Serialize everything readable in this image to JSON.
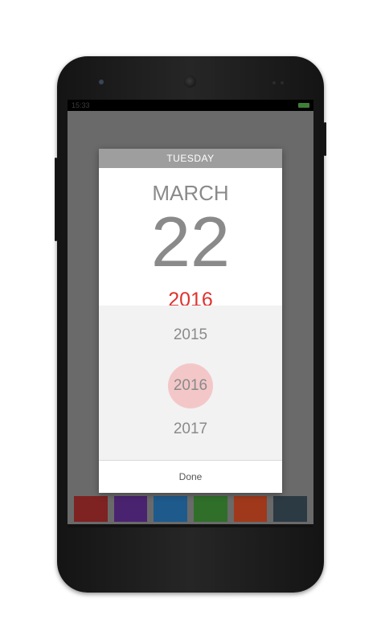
{
  "status_bar": {
    "time": "15:33"
  },
  "dialog": {
    "weekday": "TUESDAY",
    "month": "MARCH",
    "day": "22",
    "year": "2016",
    "years": [
      "2015",
      "2016",
      "2017"
    ],
    "selected_year": "2016",
    "done_label": "Done"
  },
  "colors": {
    "accent": "#e0322e",
    "selected_circle": "#f3c7c8",
    "swatches": [
      "#7e2222",
      "#4a2370",
      "#1e5a8c",
      "#2f6f2a",
      "#a0391b",
      "#2c3a44"
    ]
  }
}
